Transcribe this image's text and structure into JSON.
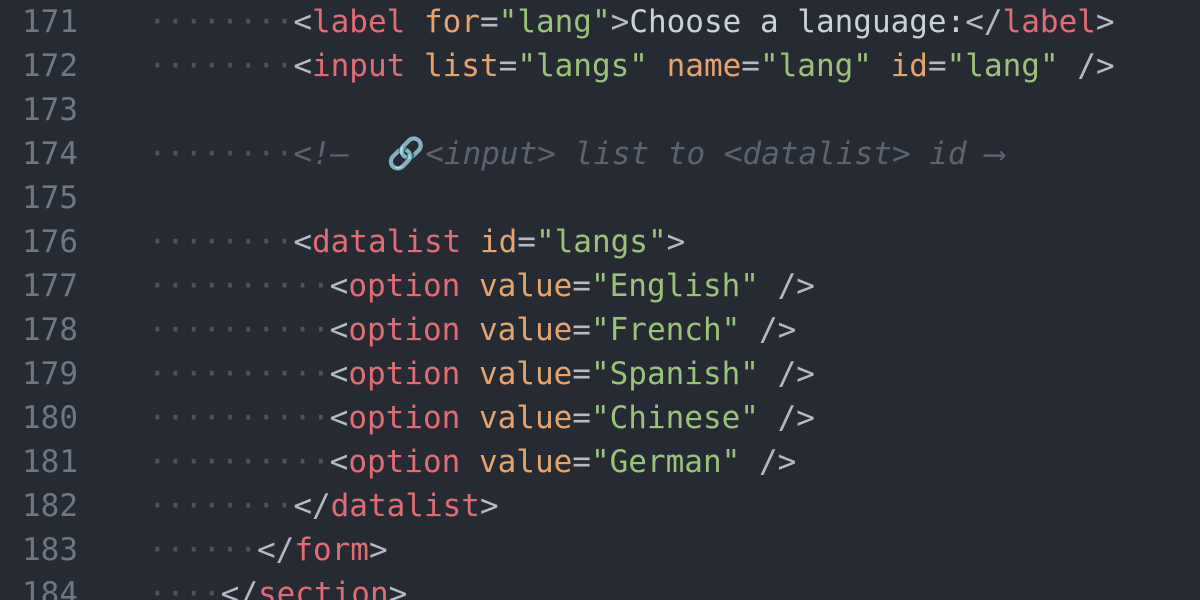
{
  "editor": {
    "background": "#262a33",
    "colors": {
      "line_number": "#6d7786",
      "tag": "#e06c75",
      "attribute": "#e5a46b",
      "string": "#98c379",
      "punctuation": "#b3bac5",
      "comment": "#5c6370",
      "text": "#c9d1d9"
    },
    "lines": [
      {
        "number": "171"
      },
      {
        "number": "172"
      },
      {
        "number": "173"
      },
      {
        "number": "174"
      },
      {
        "number": "175"
      },
      {
        "number": "176"
      },
      {
        "number": "177"
      },
      {
        "number": "178"
      },
      {
        "number": "179"
      },
      {
        "number": "180"
      },
      {
        "number": "181"
      },
      {
        "number": "182"
      },
      {
        "number": "183"
      },
      {
        "number": "184"
      }
    ],
    "code": {
      "l171": {
        "indent": "········",
        "tag": "label",
        "attr": "for",
        "value": "\"lang\"",
        "text": "Choose a language:",
        "close_tag": "label"
      },
      "l172": {
        "indent": "········",
        "tag": "input",
        "attr1": "list",
        "value1": "\"langs\"",
        "attr2": "name",
        "value2": "\"lang\"",
        "attr3": "id",
        "value3": "\"lang\""
      },
      "l174": {
        "indent": "········",
        "comment": "<!—  <input> list to <datalist> id ⟶",
        "icon": "link-icon"
      },
      "l176": {
        "indent": "········",
        "tag": "datalist",
        "attr": "id",
        "value": "\"langs\""
      },
      "l177": {
        "indent": "··········",
        "tag": "option",
        "attr": "value",
        "value": "\"English\""
      },
      "l178": {
        "indent": "··········",
        "tag": "option",
        "attr": "value",
        "value": "\"French\""
      },
      "l179": {
        "indent": "··········",
        "tag": "option",
        "attr": "value",
        "value": "\"Spanish\""
      },
      "l180": {
        "indent": "··········",
        "tag": "option",
        "attr": "value",
        "value": "\"Chinese\""
      },
      "l181": {
        "indent": "··········",
        "tag": "option",
        "attr": "value",
        "value": "\"German\""
      },
      "l182": {
        "indent": "········",
        "close_tag": "datalist"
      },
      "l183": {
        "indent": "······",
        "close_tag": "form"
      },
      "l184": {
        "indent": "····",
        "close_tag": "section"
      }
    }
  }
}
